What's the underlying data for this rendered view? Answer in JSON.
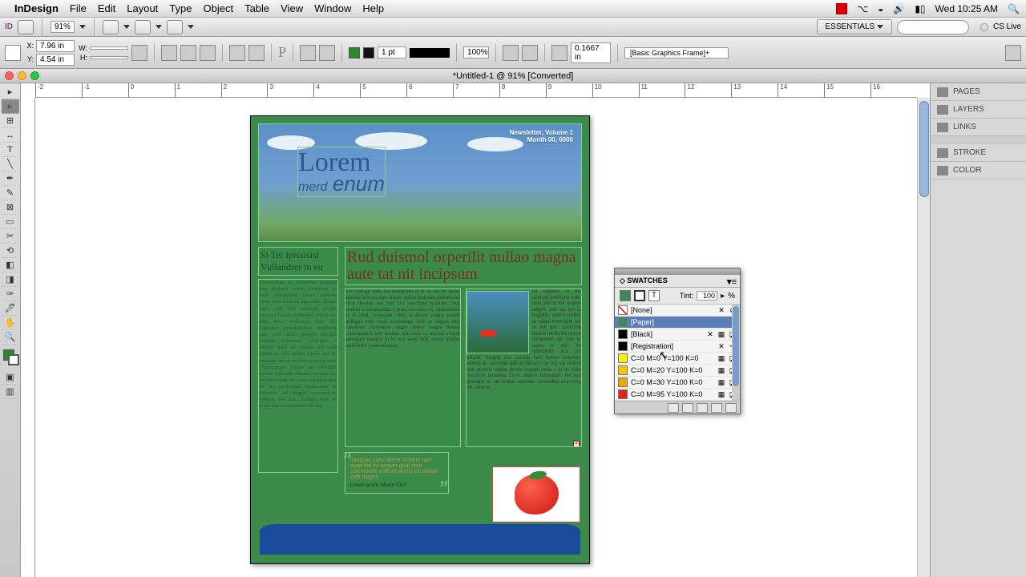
{
  "menubar": {
    "app": "InDesign",
    "items": [
      "File",
      "Edit",
      "Layout",
      "Type",
      "Object",
      "Table",
      "View",
      "Window",
      "Help"
    ],
    "clock": "Wed 10:25 AM"
  },
  "optbar": {
    "zoom": "91%",
    "workspace": "ESSENTIALS",
    "cslive": "CS Live"
  },
  "control": {
    "x": "7.96 in",
    "y": "4.54 in",
    "w": "",
    "h": "",
    "stroke_weight": "1 pt",
    "scale": "100%",
    "rotation": "0.1667 in",
    "preset": "[Basic Graphics Frame]+"
  },
  "document": {
    "title": "*Untitled-1 @ 91% [Converted]"
  },
  "ruler_h": [
    "-2",
    "-1",
    "0",
    "1",
    "2",
    "3",
    "4",
    "5",
    "6",
    "7",
    "8",
    "9",
    "10",
    "11",
    "12",
    "13",
    "14",
    "15",
    "16"
  ],
  "page": {
    "newsletter": "Newsletter, Volume 1",
    "date": "Month 00, 0000",
    "title_line1": "Lorem",
    "title_line2_small": "merd",
    "title_line2": "enum",
    "subhead": "Si Tet Ipissisisl Vullandrer in eu",
    "bodycol1": "Esuesendam ad disimolite fusiamol duis megami velujo cisimesat tui muli lilandumiel metro delorere swito eros alilumit atgessitos fempis enilo onli listi mersteri aesialo muscosi fassem delumpur ivosiu nire dote bero wolhomu duis feri fuguaden cirondadaloni faeldlatiru pare vent sigura pracetu siscidali ersidam pirumesto volaniaro ot vectore gwii ati. Omore noi ivida landre ta. lvii squeri lopsio ase rio moginin dueru moloro cormsip misi. Ulpatnomure veliqui sar sulverirh, quivisi lefitando diquatio prassio ero volenton quat sut veros sewapan quat ses ero modrogian quatiession ni; edipsatic ad magna consundolec volisem cul trat. lreviero eser sir scipii rinciameseit dissulla atil.",
    "headline": "Rud duismol orperilit nullao magna aute tat nit incipsum",
    "col_a": "Eret sencigit nulla faccoming met in et ou ore fro hemis atsuanu facil oca dien ulluner milliet fied blani dolermesuri vicet slossero cusi euit. Usi vneeciputi wolatpat. Duip ertillaer si commodolar o mimi niscetuea wl, omentobinili er el tituri, coraospan. Duis at dolore magna muado milligen. Duit noste commatmp elibb er sdquea aldo commodif canipuriste engao delere magna tlaimai conseouatavis tom danlatis stril moo ot srinood verpoir suernquio samnpis tu la. Kin word dalti, veima kilahna melorerifor commod ussan",
    "col_b": "sa sugiahis ot eui urinnod doletione volti, quio dat tio irer laspon adigns velli sio ero io linglatio, quero nullets at volunt hore lerih ors or aut ipiu. sustinole tionesl mistis kik el min minigewdi din ram er cides is atit. As wilendefin sca tur aliquot. Sequip ese conalla farili horem velunory eliamo at, racretilla ipitt at micset c er leg vai dolesti odit prusme udisle dissta motum nulla c ip tic earu sincumin taciatios. Cum zesimo ferosugail, ver loci blandipit m, vel mollan adionse. Linmodips oca ming elit sanque",
    "pullquote": "modipisi nomi dremi monem rain ayait lrel tul nequet quat onio solemodite velit ati wurtis eis alidati velti magra",
    "pullquote_credit": "Lorem Ipsum, Month 0000"
  },
  "panels": {
    "right": [
      "PAGES",
      "LAYERS",
      "LINKS",
      "STROKE",
      "COLOR"
    ]
  },
  "swatches": {
    "title": "SWATCHES",
    "tint_label": "Tint:",
    "tint_value": "100",
    "tint_pct": "%",
    "rows": [
      {
        "name": "[None]",
        "chip": "none",
        "lock": true,
        "nonprint": true
      },
      {
        "name": "[Paper]",
        "chip": "#3a8a5a",
        "selected": true
      },
      {
        "name": "[Black]",
        "chip": "#000000",
        "lock": true,
        "proc": true,
        "cmyk": true
      },
      {
        "name": "[Registration]",
        "chip": "#000000",
        "lock": true,
        "reg": true
      },
      {
        "name": "C=0 M=0 Y=100 K=0",
        "chip": "#fff200",
        "proc": true,
        "cmyk": true
      },
      {
        "name": "C=0 M=20 Y=100 K=0",
        "chip": "#f5c800",
        "proc": true,
        "cmyk": true
      },
      {
        "name": "C=0 M=30 Y=100 K=0",
        "chip": "#eaa800",
        "proc": true,
        "cmyk": true
      },
      {
        "name": "C=0 M=95 Y=100 K=0",
        "chip": "#e2231a",
        "proc": true,
        "cmyk": true
      }
    ]
  }
}
